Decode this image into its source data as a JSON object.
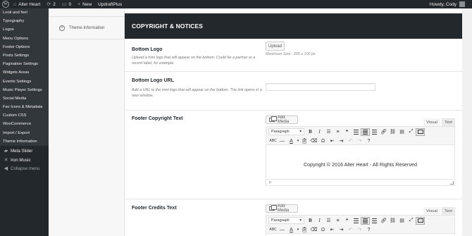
{
  "admin_bar": {
    "site_name": "Alter Heart",
    "updates_count": "2",
    "comments_count": "0",
    "new_label": "New",
    "plugin_label": "UpdraftPlus",
    "howdy": "Howdy, Cody"
  },
  "admin_menu": {
    "submenu_items": [
      "Look and feel",
      "Typography",
      "Logos",
      "Menu Options",
      "Footer Options",
      "Posts Settings",
      "Pagination Settings",
      "Widgets Areas",
      "Events Settings",
      "Music Player Settings",
      "Social Media",
      "Fav Icons & Metadata",
      "Custom CSS",
      "WooCommerce",
      "Import / Export",
      "Theme Information"
    ],
    "meta_slider": "Meta Slider",
    "iron_music": "Iron Music",
    "collapse": "Collapse menu"
  },
  "options_nav": {
    "theme_information": "Theme Information"
  },
  "section": {
    "title": "COPYRIGHT & NOTICES"
  },
  "fields": {
    "bottom_logo": {
      "title": "Bottom Logo",
      "description": "Upload a mini logo that will appear on the bottom. Could be a partner or a record label, for example.",
      "button": "Upload",
      "hint": "Maximum Size : 200 x 100 px"
    },
    "bottom_logo_url": {
      "title": "Bottom Logo URL",
      "description": "Add a URL to the mini logo that will appear on the bottom. The link opens in a new window.",
      "value": ""
    },
    "footer_copyright": {
      "title": "Footer Copyright Text",
      "add_media": "Add Media",
      "tab_visual": "Visual",
      "tab_text": "Text",
      "format": "Paragraph",
      "content": "Copyright © 2016 Alter Heart - All Rights Reserved",
      "path": "p"
    },
    "footer_credits": {
      "title": "Footer Credits Text",
      "add_media": "Add Media",
      "tab_visual": "Visual",
      "tab_text": "Text",
      "format": "Paragraph"
    }
  },
  "toolbar_icons": {
    "bold": "B",
    "italic": "I",
    "strike": "ABC",
    "text_color": "A"
  }
}
